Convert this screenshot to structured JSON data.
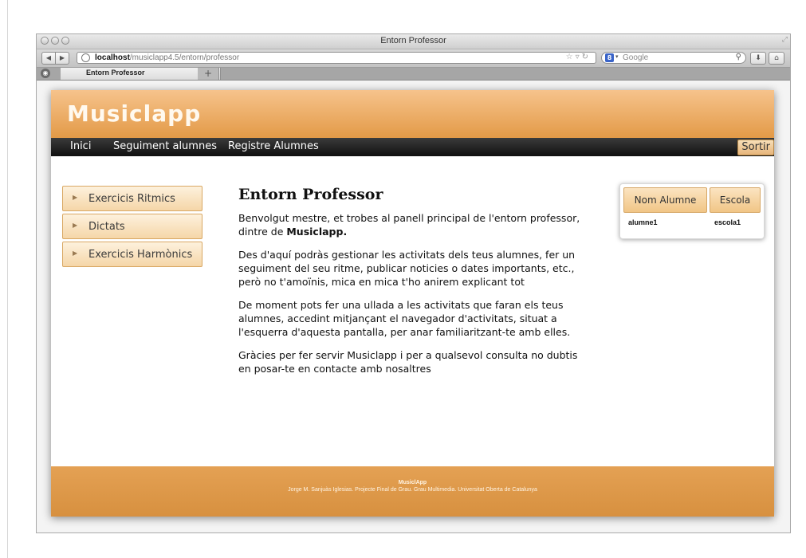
{
  "browser": {
    "window_title": "Entorn Professor",
    "url_host": "localhost",
    "url_path": "/musiclapp4.5/entorn/professor",
    "search_placeholder": "Google",
    "tab_title": "Entorn Professor"
  },
  "site": {
    "logo": "Musiclapp",
    "menu": [
      "Inici",
      "Seguiment alumnes",
      "Registre Alumnes"
    ],
    "logout_label": "Sortir",
    "sidebar": [
      "Exercicis Ritmics",
      "Dictats",
      "Exercicis Harmònics"
    ],
    "main": {
      "title": "Entorn Professor",
      "intro": "Benvolgut mestre, et trobes al panell principal de l'entorn professor, dintre de ",
      "intro_app": "Musiclapp.",
      "p2": "Des d'aquí podràs gestionar les activitats dels teus alumnes, fer un seguiment del seu ritme, publicar noticies o dates importants, etc., però no t'amoïnis, mica en mica t'ho anirem explicant tot",
      "p3": "De moment pots fer una ullada a les activitats que faran els teus alumnes, accedint mitjançant el navegador d'activitats, situat a l'esquerra d'aquesta pantalla, per anar familiaritzant-te amb elles.",
      "p4": "Gràcies per fer servir Musiclapp i per a qualsevol consulta no dubtis en posar-te en contacte amb nosaltres"
    },
    "students_table": {
      "headers": [
        "Nom Alumne",
        "Escola"
      ],
      "rows": [
        [
          "alumne1",
          "escola1"
        ]
      ]
    },
    "footer": {
      "title": "MusiclApp",
      "credit": "Jorge M. Sanjuàs Iglesias. Projecte Final de Grau. Grau Multimedia. Universitat Oberta de Catalunya"
    }
  },
  "colors": {
    "header_orange": "#e39a47",
    "menubar_black": "#101010",
    "footer_orange": "#d7903f"
  }
}
